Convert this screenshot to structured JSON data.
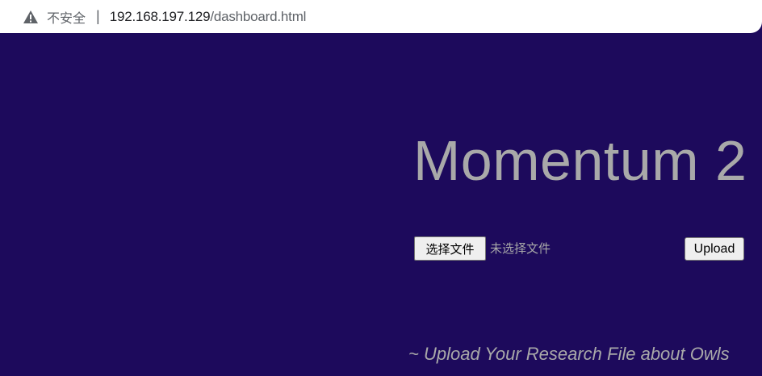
{
  "browser": {
    "security_label": "不安全",
    "separator": "|",
    "url_host": "192.168.197.129",
    "url_path": "/dashboard.html",
    "security_icon": "warning-triangle-icon"
  },
  "page": {
    "title": "Momentum 2",
    "file_input": {
      "button_label": "选择文件",
      "status_text": "未选择文件"
    },
    "upload_label": "Upload",
    "tagline": "~ Upload Your Research File about Owls"
  },
  "colors": {
    "background": "#1d0a5c",
    "text_gray": "#a9a9a9"
  }
}
